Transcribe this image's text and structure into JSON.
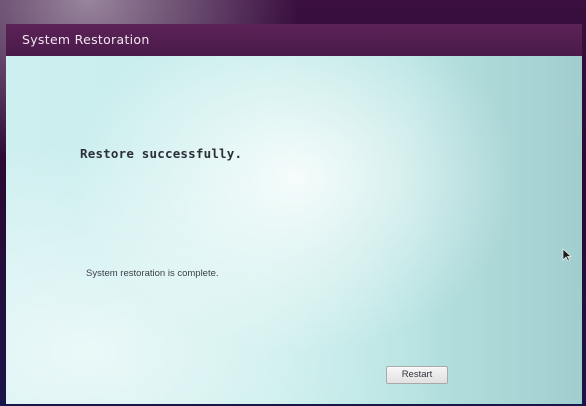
{
  "window": {
    "title": "System Restoration"
  },
  "main": {
    "heading": "Restore successfully.",
    "message": "System restoration is complete.",
    "restart_label": "Restart"
  },
  "icons": {
    "cursor": "mouse-pointer-icon"
  }
}
